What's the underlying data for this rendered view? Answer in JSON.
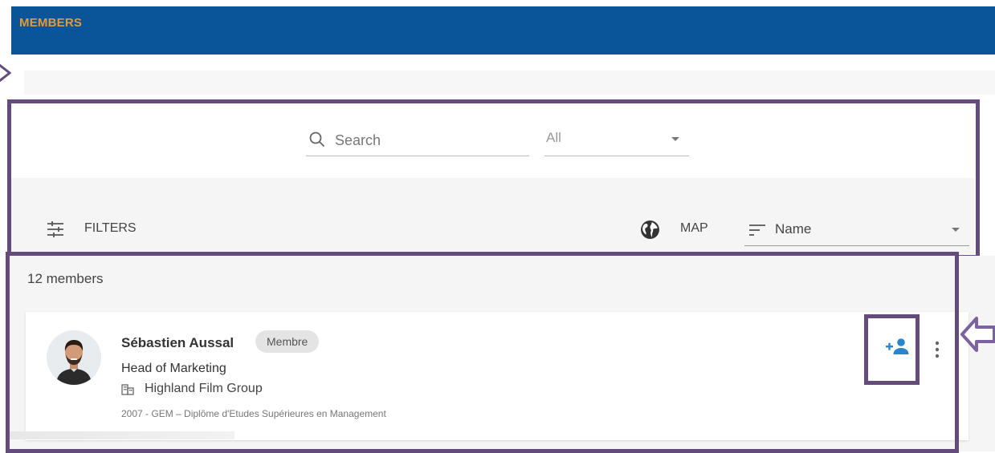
{
  "header": {
    "title": "MEMBERS"
  },
  "search": {
    "placeholder": "Search",
    "value": ""
  },
  "scope_select": {
    "selected": "All"
  },
  "toolbar": {
    "filters_label": "FILTERS",
    "map_label": "MAP",
    "sort_selected": "Name"
  },
  "results": {
    "count_label": "12 members",
    "members": [
      {
        "name": "Sébastien Aussal",
        "badge": "Membre",
        "job_title": "Head of Marketing",
        "company": "Highland Film Group",
        "education": "2007 - GEM – Diplôme d'Etudes Supérieures en Management"
      }
    ]
  },
  "colors": {
    "header_bg": "#0a5499",
    "header_title": "#e39a3c",
    "highlight_outline": "#634b7c",
    "arrow": "#7b62a3",
    "add_contact_icon": "#2a86c9"
  },
  "icons": {
    "search": "search-icon",
    "filters": "tune-icon",
    "map": "globe-icon",
    "sort": "sort-icon",
    "company": "building-icon",
    "add_contact": "person-add-icon",
    "more": "more-vertical-icon"
  }
}
